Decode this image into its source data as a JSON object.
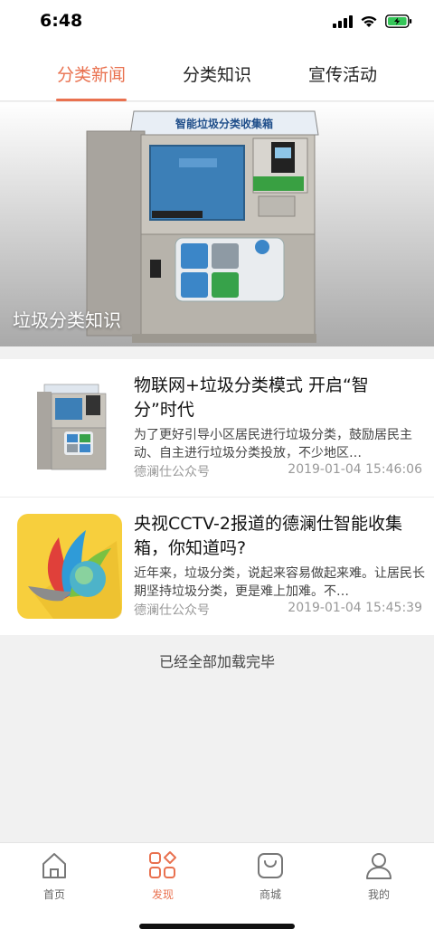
{
  "status_bar": {
    "time": "6:48"
  },
  "tabs": [
    {
      "label": "分类新闻",
      "active": true
    },
    {
      "label": "分类知识",
      "active": false
    },
    {
      "label": "宣传活动",
      "active": false
    }
  ],
  "banner": {
    "caption": "垃圾分类知识",
    "machine_sign": "智能垃圾分类收集箱"
  },
  "news": [
    {
      "title": "物联网+垃圾分类模式 开启“智分”时代",
      "summary": "为了更好引导小区居民进行垃圾分类，鼓励居民主动、自主进行垃圾分类投放，不少地区…",
      "source": "德澜仕公众号",
      "time": "2019-01-04 15:46:06"
    },
    {
      "title": "央视CCTV-2报道的德澜仕智能收集箱，你知道吗?",
      "summary": " 近年来，垃圾分类，说起来容易做起来难。让居民长期坚持垃圾分类，更是难上加难。不…",
      "source": "德澜仕公众号",
      "time": "2019-01-04 15:45:39"
    }
  ],
  "load_status": "已经全部加载完毕",
  "bottom_nav": [
    {
      "label": "首页",
      "icon": "home-icon",
      "active": false
    },
    {
      "label": "发现",
      "icon": "discover-icon",
      "active": true
    },
    {
      "label": "商城",
      "icon": "shop-bag-icon",
      "active": false
    },
    {
      "label": "我的",
      "icon": "profile-icon",
      "active": false
    }
  ],
  "colors": {
    "accent": "#e9714f",
    "background": "#f1f1f1"
  }
}
